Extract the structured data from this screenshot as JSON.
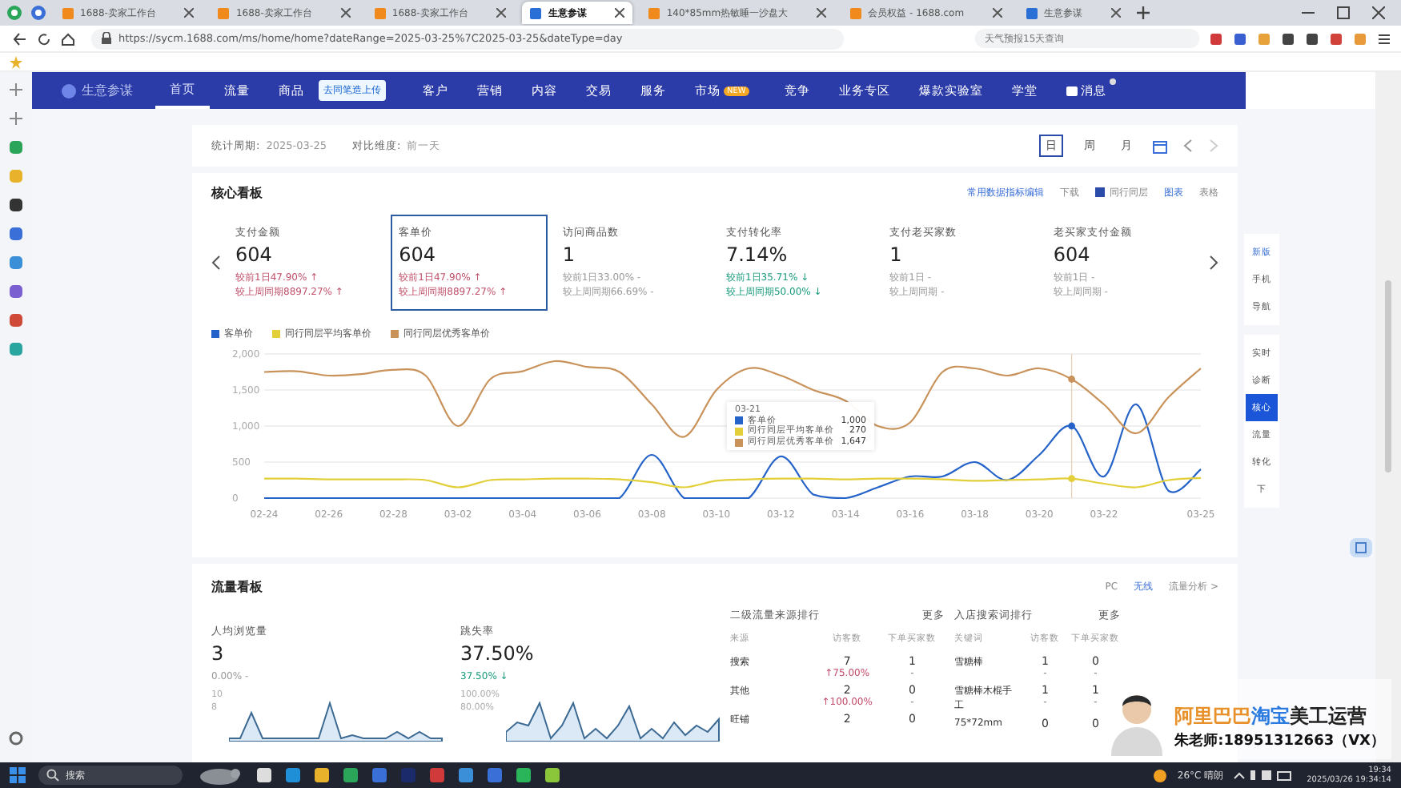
{
  "browser": {
    "tabs": [
      {
        "title": "1688-卖家工作台",
        "color": "#f08a1c",
        "selected": false
      },
      {
        "title": "1688-卖家工作台",
        "color": "#f08a1c",
        "selected": false
      },
      {
        "title": "1688-卖家工作台",
        "color": "#f08a1c",
        "selected": false
      },
      {
        "title": "生意参谋",
        "color": "#2a6fd6",
        "selected": true
      },
      {
        "title": "140*85mm热敏睡一沙盘大",
        "color": "#f08a1c",
        "selected": false
      },
      {
        "title": "会员权益 - 1688.com",
        "color": "#f08a1c",
        "selected": false
      },
      {
        "title": "生意参谋",
        "color": "#2a6fd6",
        "selected": false
      }
    ],
    "url": "https://sycm.1688.com/ms/home/home?dateRange=2025-03-25%7C2025-03-25&dateType=day",
    "search_placeholder": "天气预报15天查询"
  },
  "nav": {
    "logo": "生意参谋",
    "tooltip": "去同笔造上传",
    "items": [
      {
        "label": "首页",
        "selected": true
      },
      {
        "label": "流量",
        "selected": false
      },
      {
        "label": "商品",
        "selected": false
      },
      {
        "label": "客户",
        "selected": false
      },
      {
        "label": "营销",
        "selected": false
      },
      {
        "label": "内容",
        "selected": false
      },
      {
        "label": "交易",
        "selected": false
      },
      {
        "label": "服务",
        "selected": false
      },
      {
        "label": "市场",
        "selected": false,
        "badge": "NEW"
      },
      {
        "label": "竞争",
        "selected": false
      },
      {
        "label": "业务专区",
        "selected": false
      },
      {
        "label": "爆款实验室",
        "selected": false
      },
      {
        "label": "学堂",
        "selected": false
      },
      {
        "label": "消息",
        "selected": false,
        "kind": "message"
      }
    ]
  },
  "period": {
    "label": "统计周期:",
    "value": "2025-03-25",
    "compare_label": "对比维度:",
    "compare_value": "前一天",
    "ranges": [
      {
        "label": "日",
        "selected": true
      },
      {
        "label": "周",
        "selected": false
      },
      {
        "label": "月",
        "selected": false
      }
    ]
  },
  "core": {
    "title": "核心看板",
    "actions": [
      "常用数据指标编辑",
      "下载"
    ],
    "peer": {
      "label": "同行同层",
      "checked": true
    },
    "view": [
      "图表",
      "表格"
    ],
    "metrics": [
      {
        "label": "支付金额",
        "value": "604",
        "selected": false,
        "changes": [
          {
            "text": "较前1日47.90% ↑",
            "color": "#c0506a"
          },
          {
            "text": "较上周同期8897.27% ↑",
            "color": "#c0506a"
          }
        ]
      },
      {
        "label": "客单价",
        "value": "604",
        "selected": true,
        "changes": [
          {
            "text": "较前1日47.90% ↑",
            "color": "#c0506a"
          },
          {
            "text": "较上周同期8897.27% ↑",
            "color": "#c0506a"
          }
        ]
      },
      {
        "label": "访问商品数",
        "value": "1",
        "selected": false,
        "changes": [
          {
            "text": "较前1日33.00% -",
            "color": "#999999"
          },
          {
            "text": "较上周同期66.69% -",
            "color": "#999999"
          }
        ]
      },
      {
        "label": "支付转化率",
        "value": "7.14%",
        "selected": false,
        "changes": [
          {
            "text": "较前1日35.71% ↓",
            "color": "#1a9b7e"
          },
          {
            "text": "较上周同期50.00% ↓",
            "color": "#1a9b7e"
          }
        ]
      },
      {
        "label": "支付老买家数",
        "value": "1",
        "selected": false,
        "changes": [
          {
            "text": "较前1日 -",
            "color": "#999999"
          },
          {
            "text": "较上周同期 -",
            "color": "#999999"
          }
        ]
      },
      {
        "label": "老买家支付金额",
        "value": "604",
        "selected": false,
        "changes": [
          {
            "text": "较前1日 -",
            "color": "#999999"
          },
          {
            "text": "较上周同期 -",
            "color": "#999999"
          }
        ]
      }
    ],
    "chart_data": {
      "type": "line",
      "legend": "top",
      "grid": true,
      "categories": [
        "02-24",
        null,
        "02-26",
        null,
        "02-28",
        null,
        "03-02",
        null,
        "03-04",
        null,
        "03-06",
        null,
        "03-08",
        null,
        "03-10",
        null,
        "03-12",
        null,
        "03-14",
        null,
        "03-16",
        null,
        "03-18",
        null,
        "03-20",
        null,
        "03-22",
        null,
        null,
        "03-25"
      ],
      "series": [
        {
          "name": "客单价",
          "color": "#2563c9",
          "values": [
            0,
            0,
            0,
            0,
            0,
            0,
            0,
            0,
            0,
            0,
            0,
            0,
            600,
            0,
            0,
            0,
            580,
            50,
            0,
            150,
            300,
            300,
            500,
            250,
            600,
            1000,
            300,
            1300,
            100,
            400
          ]
        },
        {
          "name": "同行同层平均客单价",
          "color": "#e3cf3a",
          "values": [
            270,
            270,
            260,
            260,
            260,
            250,
            150,
            250,
            260,
            270,
            270,
            260,
            220,
            150,
            240,
            260,
            270,
            270,
            260,
            270,
            270,
            260,
            240,
            250,
            260,
            270,
            200,
            150,
            250,
            280
          ]
        },
        {
          "name": "同行同层优秀客单价",
          "color": "#c8925a",
          "values": [
            1750,
            1760,
            1700,
            1720,
            1780,
            1700,
            1000,
            1650,
            1760,
            1900,
            1820,
            1750,
            1300,
            850,
            1500,
            1800,
            1700,
            1500,
            1350,
            1000,
            1050,
            1750,
            1800,
            1700,
            1800,
            1650,
            1300,
            900,
            1400,
            1800
          ]
        }
      ],
      "ylim": [
        0,
        2000
      ],
      "yticks": [
        0,
        {
          "value": 500,
          "label": "500"
        },
        {
          "value": 1000,
          "label": "1,000"
        },
        {
          "value": 1500,
          "label": "1,500"
        },
        {
          "value": 2000,
          "label": "2,000"
        }
      ]
    },
    "tooltip": {
      "title": "03-21",
      "rows": [
        {
          "name": "客单价",
          "value": "1,000"
        },
        {
          "name": "同行同层平均客单价",
          "value": "270"
        },
        {
          "name": "同行同层优秀客单价",
          "value": "1,647"
        }
      ]
    }
  },
  "traffic": {
    "title": "流量看板",
    "platforms": [
      "PC",
      "无线"
    ],
    "analysis_link": "流量分析 >",
    "metrics": [
      {
        "label": "人均浏览量",
        "value": "3",
        "change": "0.00% -",
        "color": "#999999",
        "ticks": [
          "10",
          "8"
        ]
      },
      {
        "label": "跳失率",
        "value": "37.50%",
        "change": "37.50% ↓",
        "color": "#1a9b7e",
        "ticks": [
          "100.00%",
          "80.00%"
        ]
      }
    ],
    "tables": [
      {
        "title": "二级流量来源排行",
        "more": "更多",
        "columns": [
          "来源",
          "访客数",
          "下单买家数"
        ],
        "rows": [
          {
            "cells": [
              "搜索",
              "7",
              "1"
            ],
            "notes": [
              "↑75.00%",
              "-"
            ]
          },
          {
            "cells": [
              "其他",
              "2",
              "0"
            ],
            "notes": [
              "↑100.00%",
              "-"
            ]
          },
          {
            "cells": [
              "旺铺",
              "2",
              "0"
            ],
            "notes": []
          }
        ]
      },
      {
        "title": "入店搜索词排行",
        "more": "更多",
        "columns": [
          "关键词",
          "访客数",
          "下单买家数"
        ],
        "rows": [
          {
            "cells": [
              "雪糖棒",
              "1",
              "0"
            ],
            "notes": [
              "-",
              "-"
            ]
          },
          {
            "cells": [
              "雪糖棒木棍手工",
              "1",
              "1"
            ],
            "notes": [
              "-",
              "-"
            ]
          },
          {
            "cells": [
              "75*72mm",
              "0",
              "0"
            ],
            "notes": []
          }
        ]
      }
    ]
  },
  "side_panel": [
    {
      "label": "新版",
      "selected": false
    },
    {
      "label": "手机",
      "selected": false
    },
    {
      "label": "导航",
      "selected": false
    },
    {
      "label": "实时",
      "selected": false
    },
    {
      "label": "诊断",
      "selected": false
    },
    {
      "label": "核心",
      "selected": true
    },
    {
      "label": "流量",
      "selected": false
    },
    {
      "label": "转化",
      "selected": false
    },
    {
      "label": "下",
      "selected": false
    }
  ],
  "overlay": {
    "title_parts": [
      "阿里巴巴",
      "淘宝",
      "美工运营"
    ],
    "contact": "朱老师:18951312663（VX）"
  },
  "taskbar": {
    "search": "搜索",
    "weather": "26°C 晴朗",
    "time": "19:34",
    "date": "2025/03/26 19:34:14"
  }
}
